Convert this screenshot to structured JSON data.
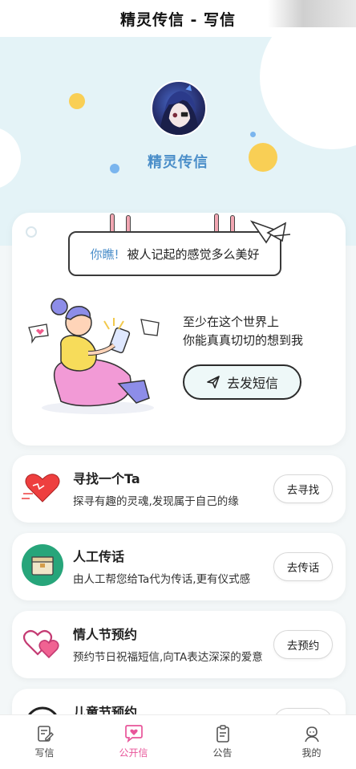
{
  "header": {
    "title": "精灵传信 - 写信"
  },
  "profile": {
    "name": "精灵传信"
  },
  "main_card": {
    "sign_accent": "你瞧!",
    "sign_text": "被人记起的感觉多么美好",
    "slogan_line1": "至少在这个世界上",
    "slogan_line2": "你能真真切切的想到我",
    "send_button": "去发短信"
  },
  "features": [
    {
      "title": "寻找一个Ta",
      "desc": "探寻有趣的灵魂,发现属于自己的缘",
      "button": "去寻找",
      "icon": "heart-icon"
    },
    {
      "title": "人工传话",
      "desc": "由人工帮您给Ta代为传话,更有仪式感",
      "button": "去传话",
      "icon": "package-icon"
    },
    {
      "title": "情人节预约",
      "desc": "预约节日祝福短信,向TA表达深深的爱意",
      "button": "去预约",
      "icon": "double-heart-icon"
    },
    {
      "title": "儿童节预约",
      "desc": "",
      "button": "",
      "icon": "clock-icon"
    }
  ],
  "tabbar": {
    "items": [
      {
        "label": "写信",
        "icon": "write-icon"
      },
      {
        "label": "公开信",
        "icon": "message-heart-icon"
      },
      {
        "label": "公告",
        "icon": "clipboard-icon"
      },
      {
        "label": "我的",
        "icon": "user-icon"
      }
    ],
    "active_color": "#e8559a"
  },
  "colors": {
    "accent": "#4b8ec9",
    "hero_bg": "#e4f3f7",
    "pink": "#e8559a"
  }
}
